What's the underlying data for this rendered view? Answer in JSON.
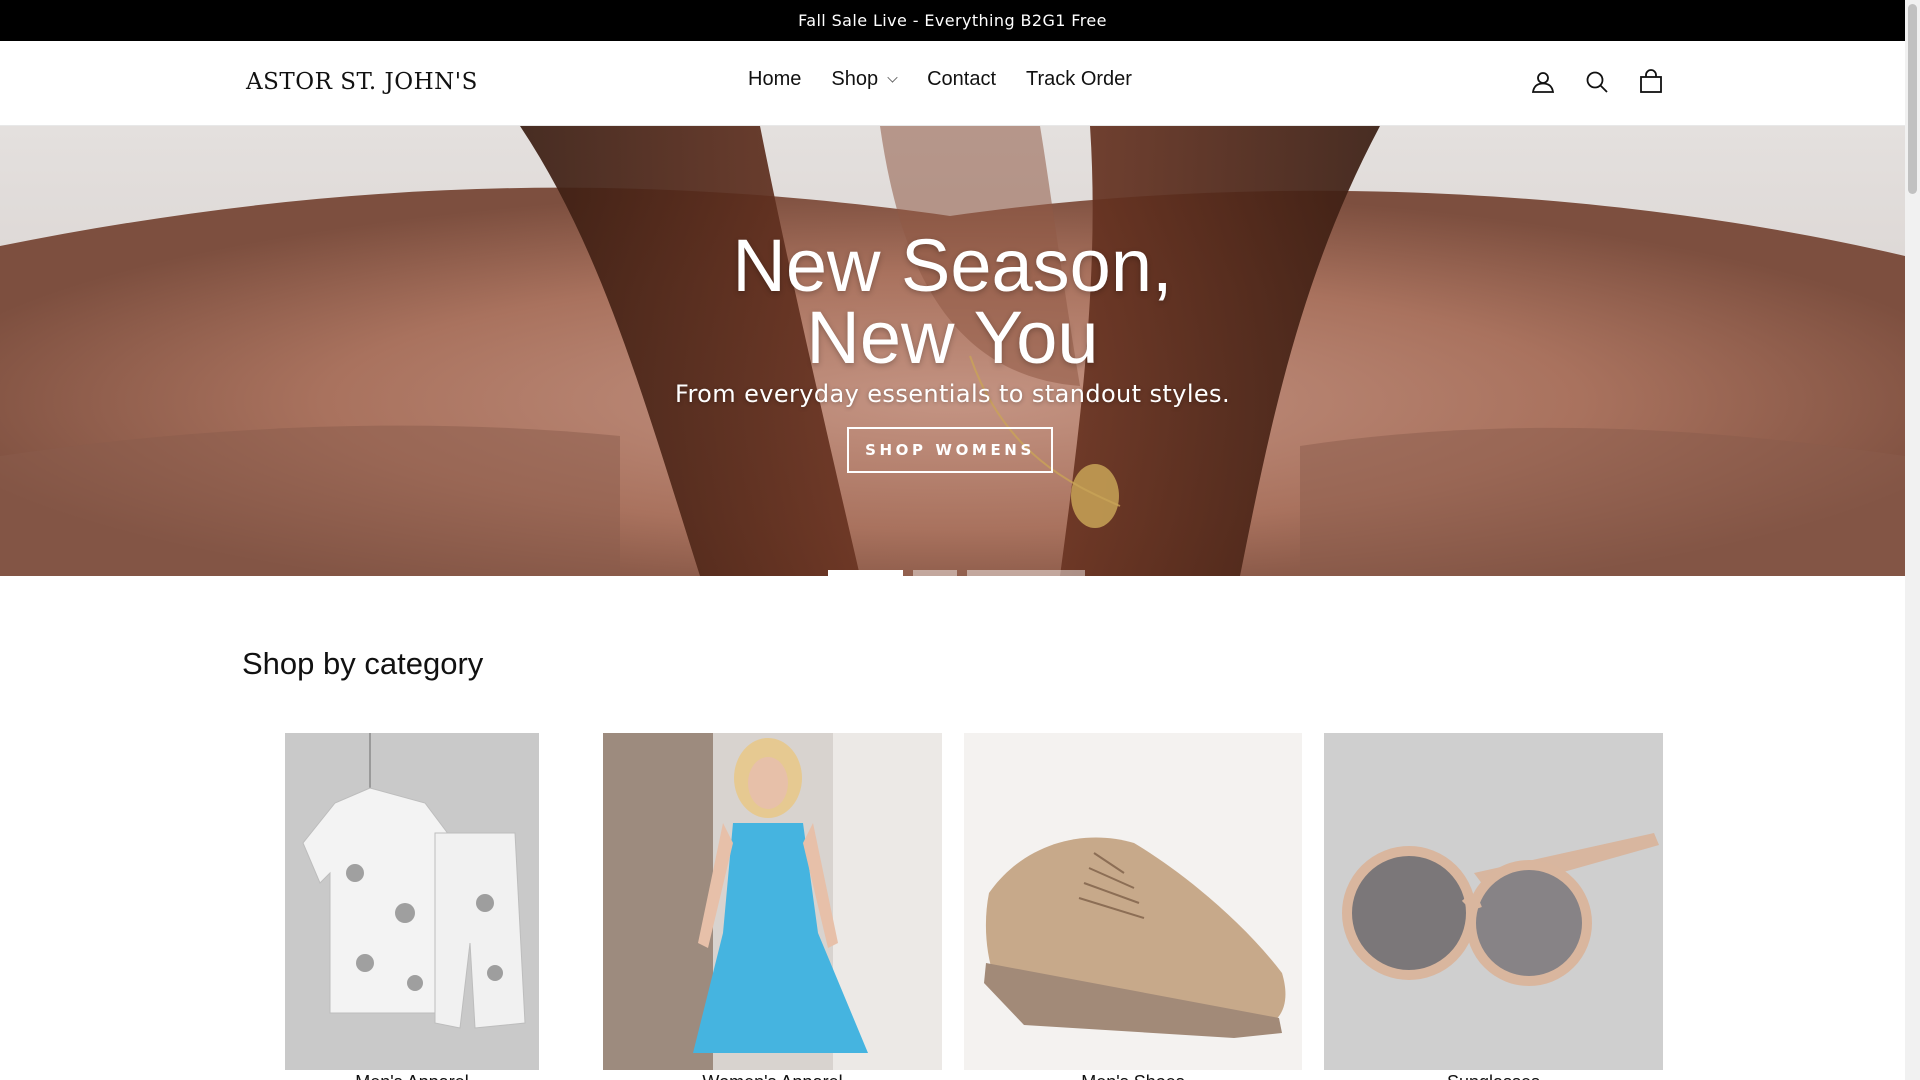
{
  "announcement": {
    "text": "Fall Sale Live - Everything B2G1 Free"
  },
  "header": {
    "logo_text": "ASTOR ST. JOHN'S",
    "nav": [
      {
        "label": "Home"
      },
      {
        "label": "Shop"
      },
      {
        "label": "Contact"
      },
      {
        "label": "Track Order"
      }
    ],
    "icons": [
      "account-icon",
      "search-icon",
      "cart-icon"
    ]
  },
  "hero": {
    "title_line1": "New Season,",
    "title_line2": "New You",
    "subtitle": "From everyday essentials to standout styles.",
    "button_label": "SHOP WOMENS",
    "slides_count": 3,
    "active_slide": 1
  },
  "categories": {
    "title": "Shop by category",
    "items": [
      {
        "label": "Men's Apparel",
        "image": "hawaiian-shirt-set"
      },
      {
        "label": "Women's Apparel",
        "image": "blue-dress"
      },
      {
        "label": "Men's Shoes",
        "image": "leather-shoe"
      },
      {
        "label": "Sunglasses",
        "image": "round-sunglasses"
      }
    ]
  },
  "colors": {
    "announcement_bg": "#000000",
    "hero_text": "#ffffff",
    "page_bg": "#ffffff"
  }
}
